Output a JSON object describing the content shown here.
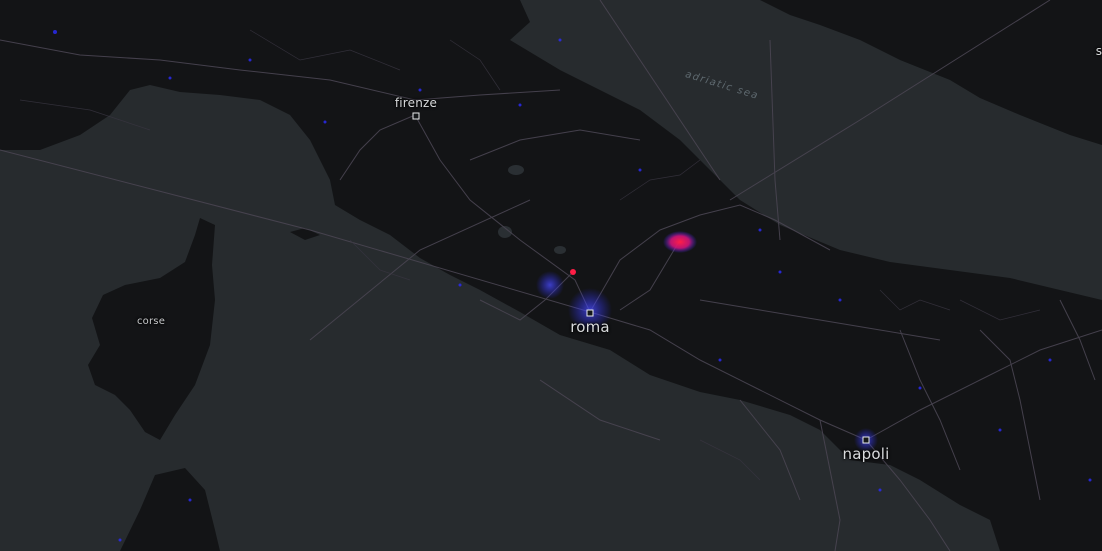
{
  "map": {
    "colors": {
      "sea": "#272b2e",
      "land": "#131416",
      "roads": "#4a4552",
      "activity_low": "#2c2cff",
      "activity_high": "#ff1e46"
    },
    "labels": {
      "firenze": "firenze",
      "roma": "roma",
      "napoli": "napoli",
      "corse": "corse",
      "adriatic_sea": "adriatic sea",
      "edge_fragment": "s"
    }
  }
}
